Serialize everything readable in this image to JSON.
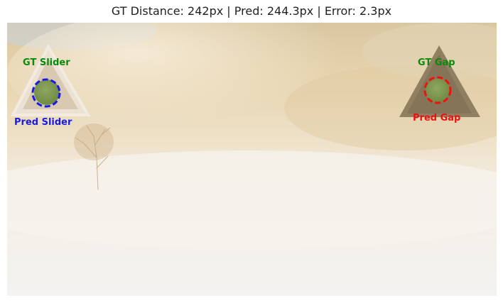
{
  "title": "GT Distance: 242px | Pred: 244.3px | Error: 2.3px",
  "labels": {
    "gt_slider": "GT Slider",
    "pred_slider": "Pred Slider",
    "gt_gap": "GT Gap",
    "pred_gap": "Pred Gap"
  },
  "colors": {
    "gt": "#0a8a0a",
    "pred_slider": "#1a1ae6",
    "pred_gap": "#ee1111"
  }
}
